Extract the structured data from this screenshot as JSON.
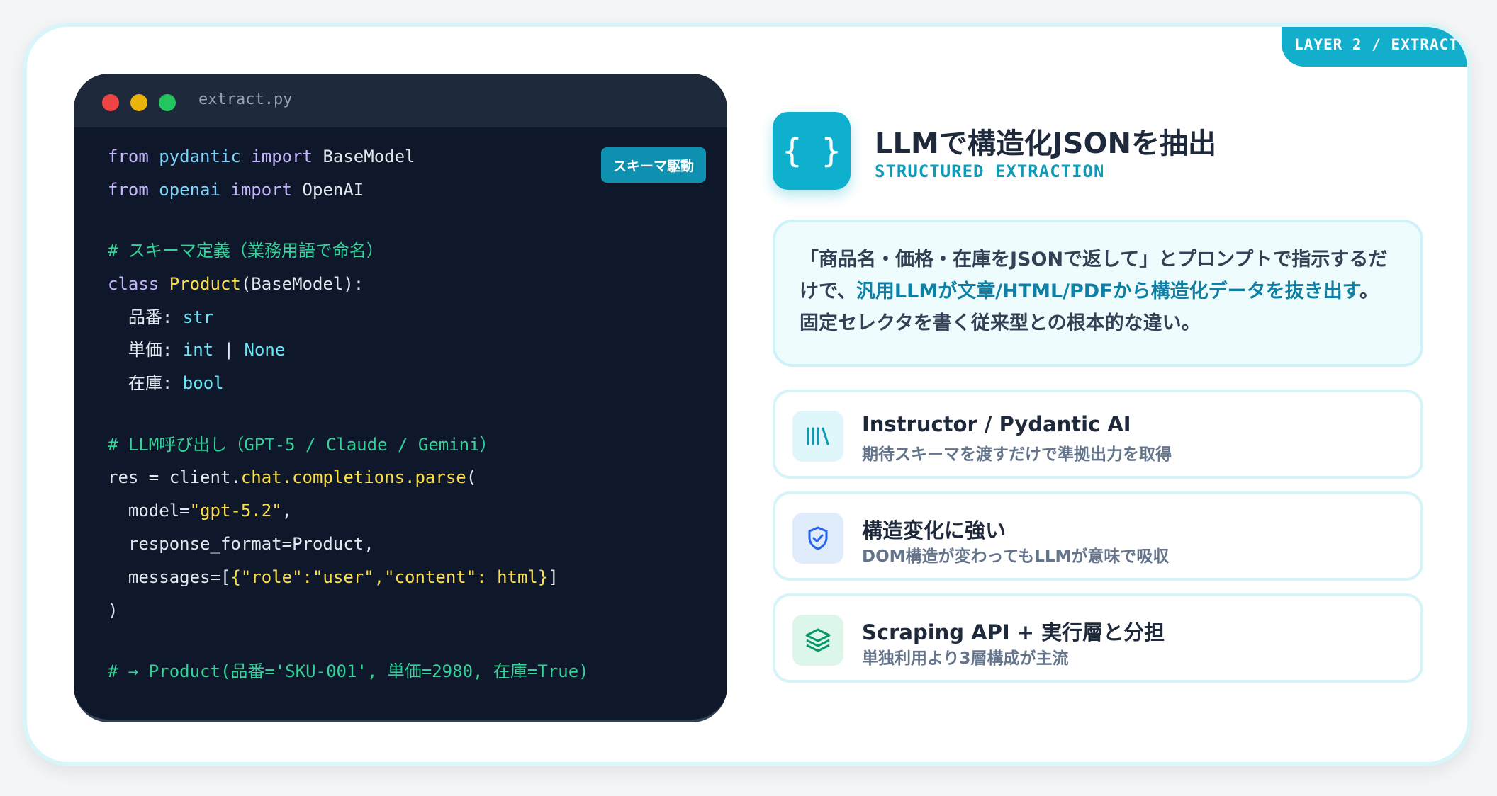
{
  "layer_badge": "LAYER 2 / EXTRACT",
  "code_window": {
    "filename": "extract.py",
    "schema_badge": "スキーマ駆動",
    "lines": {
      "l1": {
        "a": "from",
        "b": " pydantic",
        "c": " import",
        "d": " BaseModel"
      },
      "l2": {
        "a": "from",
        "b": " openai",
        "c": " import",
        "d": " OpenAI"
      },
      "l3": "# スキーマ定義（業務用語で命名）",
      "l4": {
        "a": "class",
        "b": " Product",
        "c": "(BaseModel):"
      },
      "l5": {
        "a": "  品番: ",
        "b": "str"
      },
      "l6": {
        "a": "  単価: ",
        "b": "int",
        "c": " | ",
        "d": "None"
      },
      "l7": {
        "a": "  在庫: ",
        "b": "bool"
      },
      "l8": "# LLM呼び出し（GPT-5 / Claude / Gemini）",
      "l9": {
        "a": "res = client.",
        "b": "chat.completions.parse",
        "c": "("
      },
      "l10": {
        "a": "  model=",
        "b": "\"gpt-5.2\"",
        "c": ","
      },
      "l11": "  response_format=Product,",
      "l12": {
        "a": "  messages=[",
        "b": "{\"role\":\"user\",\"content\": html}",
        "c": "]"
      },
      "l13": ")",
      "l14": "# → Product(品番='SKU-001', 単価=2980, 在庫=True)"
    }
  },
  "header": {
    "icon": "braces-icon",
    "icon_glyph": "{ }",
    "title": "LLMで構造化JSONを抽出",
    "subtitle": "STRUCTURED EXTRACTION"
  },
  "description": {
    "part1": "「商品名・価格・在庫をJSONで返して」とプロンプトで指示するだけで、",
    "highlight": "汎用LLMが文章/HTML/PDFから構造化データを抜き出す",
    "part2": "。固定セレクタを書く従来型との根本的な違い。"
  },
  "features": [
    {
      "icon": "library-icon",
      "title": "Instructor / Pydantic AI",
      "desc": "期待スキーマを渡すだけで準拠出力を取得",
      "color": "#0e9bb8",
      "bg": "#dff6fa"
    },
    {
      "icon": "shield-check-icon",
      "title": "構造変化に強い",
      "desc": "DOM構造が変わってもLLMが意味で吸収",
      "color": "#2563eb",
      "bg": "#e0ecfc"
    },
    {
      "icon": "layers-icon",
      "title": "Scraping API + 実行層と分担",
      "desc": "単独利用より3層構成が主流",
      "color": "#059669",
      "bg": "#dcf7ea"
    }
  ],
  "colors": {
    "accent": "#12aecb",
    "code_bg": "#0f172a"
  }
}
